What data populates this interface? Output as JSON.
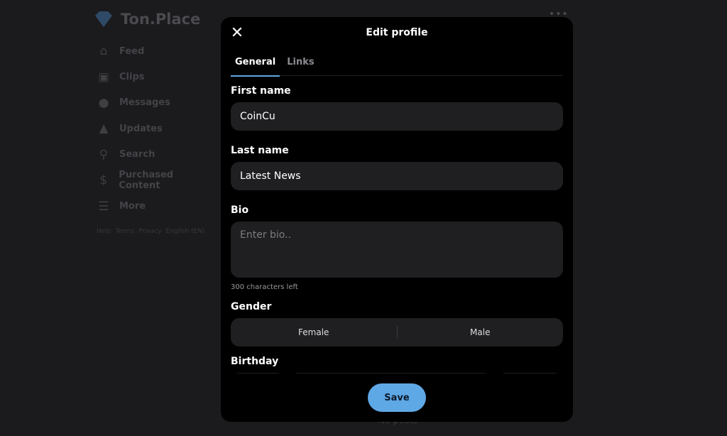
{
  "sidebar": {
    "brand": "Ton.Place",
    "items": [
      {
        "label": "Feed",
        "icon": "home-icon"
      },
      {
        "label": "Clips",
        "icon": "clips-icon"
      },
      {
        "label": "Messages",
        "icon": "chat-icon"
      },
      {
        "label": "Updates",
        "icon": "bell-icon"
      },
      {
        "label": "Search",
        "icon": "search-icon"
      },
      {
        "label": "Purchased Content",
        "icon": "dollar-icon"
      },
      {
        "label": "More",
        "icon": "menu-icon"
      }
    ],
    "footer": [
      "Help",
      "Terms",
      "Privacy",
      "English (EN)"
    ]
  },
  "background": {
    "more_dots": "•••",
    "no_posts": "No posts"
  },
  "modal": {
    "title": "Edit profile",
    "close": "✕",
    "tabs": [
      "General",
      "Links"
    ],
    "first_name_label": "First name",
    "first_name": "CoinCu",
    "last_name_label": "Last name",
    "last_name": "Latest News",
    "bio_label": "Bio",
    "bio_placeholder": "Enter bio..",
    "bio_hint": "300 characters left",
    "gender_label": "Gender",
    "gender_options": [
      "Female",
      "Male"
    ],
    "birthday_label": "Birthday",
    "save": "Save",
    "accent": "#5fa8e6"
  }
}
